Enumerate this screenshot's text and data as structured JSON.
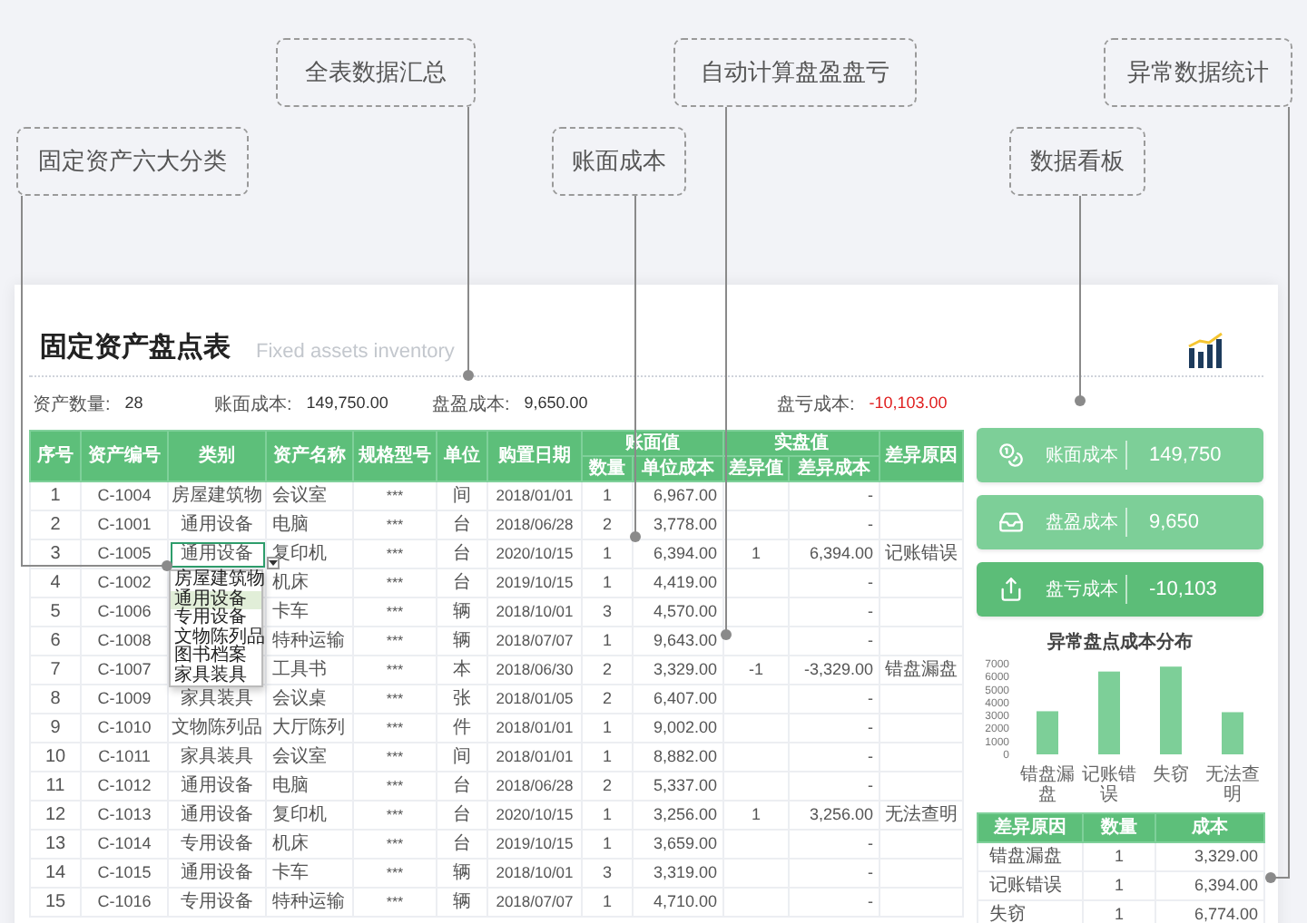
{
  "callouts": [
    "固定资产六大分类",
    "全表数据汇总",
    "账面成本",
    "自动计算盘盈盘亏",
    "数据看板",
    "异常数据统计"
  ],
  "title": "固定资产盘点表",
  "subtitle": "Fixed assets inventory",
  "summary": [
    {
      "label": "资产数量:",
      "value": "28",
      "color": "#333333"
    },
    {
      "label": "账面成本:",
      "value": "149,750.00",
      "color": "#333333"
    },
    {
      "label": "盘盈成本:",
      "value": "9,650.00",
      "color": "#333333"
    },
    {
      "label": "盘亏成本:",
      "value": "-10,103.00",
      "color": "#e02020"
    }
  ],
  "table": {
    "columns": [
      {
        "label": "序号"
      },
      {
        "label": "资产编号"
      },
      {
        "label": "类别"
      },
      {
        "label": "资产名称"
      },
      {
        "label": "规格型号"
      },
      {
        "label": "单位"
      },
      {
        "label": "购置日期"
      },
      {
        "label": "账面值",
        "children": [
          {
            "label": "数量"
          },
          {
            "label": "单位成本"
          }
        ]
      },
      {
        "label": "实盘值",
        "children": [
          {
            "label": "差异值"
          },
          {
            "label": "差异成本"
          }
        ]
      },
      {
        "label": "差异原因"
      }
    ],
    "rows": [
      {
        "no": "1",
        "code": "C-1004",
        "category": "房屋建筑物",
        "name": "会议室",
        "spec": "***",
        "unit": "间",
        "date": "2018/01/01",
        "qty": "1",
        "unit_cost": "6,967.00",
        "diff_cost": "-",
        "editing": false
      },
      {
        "no": "2",
        "code": "C-1001",
        "category": "通用设备",
        "name": "电脑",
        "spec": "***",
        "unit": "台",
        "date": "2018/06/28",
        "qty": "2",
        "unit_cost": "3,778.00",
        "diff_cost": "-",
        "editing": false
      },
      {
        "no": "3",
        "code": "C-1005",
        "category": "通用设备",
        "name": "复印机",
        "spec": "***",
        "unit": "台",
        "date": "2020/10/15",
        "qty": "1",
        "unit_cost": "6,394.00",
        "diff_qty": "1",
        "diff_cost": "6,394.00",
        "reason": "记账错误",
        "editing": true
      },
      {
        "no": "4",
        "code": "C-1002",
        "name": "机床",
        "spec": "***",
        "unit": "台",
        "date": "2019/10/15",
        "qty": "1",
        "unit_cost": "4,419.00",
        "diff_cost": "-",
        "editing": false
      },
      {
        "no": "5",
        "code": "C-1006",
        "name": "卡车",
        "spec": "***",
        "unit": "辆",
        "date": "2018/10/01",
        "qty": "3",
        "unit_cost": "4,570.00",
        "diff_cost": "-",
        "editing": false
      },
      {
        "no": "6",
        "code": "C-1008",
        "name": "特种运输",
        "spec": "***",
        "unit": "辆",
        "date": "2018/07/07",
        "qty": "1",
        "unit_cost": "9,643.00",
        "diff_cost": "-",
        "editing": false
      },
      {
        "no": "7",
        "code": "C-1007",
        "name": "工具书",
        "spec": "***",
        "unit": "本",
        "date": "2018/06/30",
        "qty": "2",
        "unit_cost": "3,329.00",
        "diff_qty": "-1",
        "diff_cost": "-3,329.00",
        "reason": "错盘漏盘",
        "editing": false
      },
      {
        "no": "8",
        "code": "C-1009",
        "category": "家具装具",
        "name": "会议桌",
        "spec": "***",
        "unit": "张",
        "date": "2018/01/05",
        "qty": "2",
        "unit_cost": "6,407.00",
        "diff_cost": "-",
        "editing": false
      },
      {
        "no": "9",
        "code": "C-1010",
        "category": "文物陈列品",
        "name": "大厅陈列",
        "spec": "***",
        "unit": "件",
        "date": "2018/01/01",
        "qty": "1",
        "unit_cost": "9,002.00",
        "diff_cost": "-",
        "editing": false
      },
      {
        "no": "10",
        "code": "C-1011",
        "category": "家具装具",
        "name": "会议室",
        "spec": "***",
        "unit": "间",
        "date": "2018/01/01",
        "qty": "1",
        "unit_cost": "8,882.00",
        "diff_cost": "-",
        "editing": false
      },
      {
        "no": "11",
        "code": "C-1012",
        "category": "通用设备",
        "name": "电脑",
        "spec": "***",
        "unit": "台",
        "date": "2018/06/28",
        "qty": "2",
        "unit_cost": "5,337.00",
        "diff_cost": "-",
        "editing": false
      },
      {
        "no": "12",
        "code": "C-1013",
        "category": "通用设备",
        "name": "复印机",
        "spec": "***",
        "unit": "台",
        "date": "2020/10/15",
        "qty": "1",
        "unit_cost": "3,256.00",
        "diff_qty": "1",
        "diff_cost": "3,256.00",
        "reason": "无法查明",
        "editing": false
      },
      {
        "no": "13",
        "code": "C-1014",
        "category": "专用设备",
        "name": "机床",
        "spec": "***",
        "unit": "台",
        "date": "2019/10/15",
        "qty": "1",
        "unit_cost": "3,659.00",
        "diff_cost": "-",
        "editing": false
      },
      {
        "no": "14",
        "code": "C-1015",
        "category": "通用设备",
        "name": "卡车",
        "spec": "***",
        "unit": "辆",
        "date": "2018/10/01",
        "qty": "3",
        "unit_cost": "3,319.00",
        "diff_cost": "-",
        "editing": false
      },
      {
        "no": "15",
        "code": "C-1016",
        "category": "专用设备",
        "name": "特种运输",
        "spec": "***",
        "unit": "辆",
        "date": "2018/07/07",
        "qty": "1",
        "unit_cost": "4,710.00",
        "diff_cost": "-",
        "editing": false
      }
    ],
    "dropdown": [
      {
        "label": "房屋建筑物",
        "selected": false
      },
      {
        "label": "通用设备",
        "selected": true
      },
      {
        "label": "专用设备",
        "selected": false
      },
      {
        "label": "文物陈列品",
        "selected": false
      },
      {
        "label": "图书档案",
        "selected": false
      },
      {
        "label": "家具装具",
        "selected": false
      }
    ]
  },
  "stat_cards": [
    {
      "kind": "book",
      "label": "账面成本",
      "value": "149,750",
      "color": "#7dcf98"
    },
    {
      "kind": "gain",
      "label": "盘盈成本",
      "value": "9,650",
      "color": "#7dcf98"
    },
    {
      "kind": "loss",
      "label": "盘亏成本",
      "value": "-10,103",
      "color": "#5cbd78"
    }
  ],
  "chart": {
    "chart_data": {
      "type": "bar",
      "title": "异常盘点成本分布",
      "categories": [
        "错盘漏盘",
        "记账错误",
        "失窃",
        "无法查明"
      ],
      "series": [
        {
          "color": "#7dcf98",
          "values": [
            3329,
            6394,
            6774,
            3256
          ]
        }
      ],
      "ylim": [
        0,
        7000
      ],
      "yticks": [
        0,
        1000,
        2000,
        3000,
        4000,
        5000,
        6000,
        7000
      ]
    }
  },
  "reason_table": {
    "columns": [
      "差异原因",
      "数量",
      "成本"
    ],
    "rows": [
      [
        "错盘漏盘",
        "1",
        "3,329.00"
      ],
      [
        "记账错误",
        "1",
        "6,394.00"
      ],
      [
        "失窃",
        "1",
        "6,774.00"
      ]
    ]
  }
}
